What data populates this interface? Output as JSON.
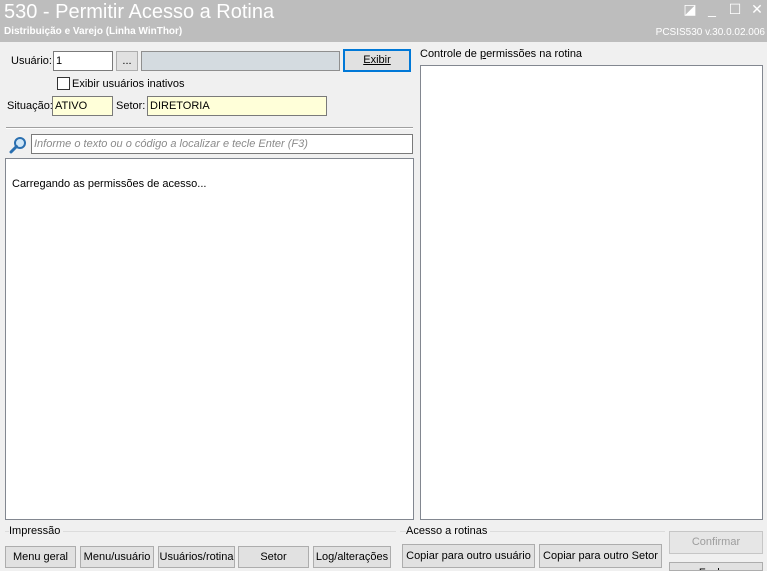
{
  "window": {
    "title": "530 - Permitir Acesso a Rotina",
    "subtitle": "Distribuição e Varejo (Linha WinThor)",
    "version": "PCSIS530  v.30.0.02.006",
    "controls": {
      "edit": "◪",
      "minimize": "_",
      "maximize": "☐",
      "close": "✕"
    }
  },
  "form": {
    "usuario_label": "Usuário:",
    "usuario_value": "1",
    "lookup_button": "...",
    "usuario_name": "",
    "exibir_button": "Exibir",
    "inativos_label": "Exibir usuários inativos",
    "inativos_checked": false,
    "situacao_label": "Situação:",
    "situacao_value": "ATIVO",
    "setor_label": "Setor:",
    "setor_value": "DIRETORIA"
  },
  "search": {
    "placeholder": "Informe o texto ou o código a localizar e tecle Enter (F3)"
  },
  "tree": {
    "loading_text": "Carregando as permissões de acesso..."
  },
  "permissions": {
    "title": "Controle de permissões na rotina"
  },
  "impressao": {
    "title": "Impressão",
    "buttons": [
      "Menu geral",
      "Menu/usuário",
      "Usuários/rotina",
      "Setor",
      "Log/alterações"
    ]
  },
  "acesso": {
    "title": "Acesso a rotinas",
    "buttons": [
      "Copiar para outro usuário",
      "Copiar para outro Setor"
    ]
  },
  "actions": {
    "confirmar": "Confirmar",
    "fechar": "Fechar"
  },
  "colors": {
    "titlebar": "#bdbdbd",
    "readonly_field": "#ffffd9",
    "focus_border": "#0078d7"
  }
}
